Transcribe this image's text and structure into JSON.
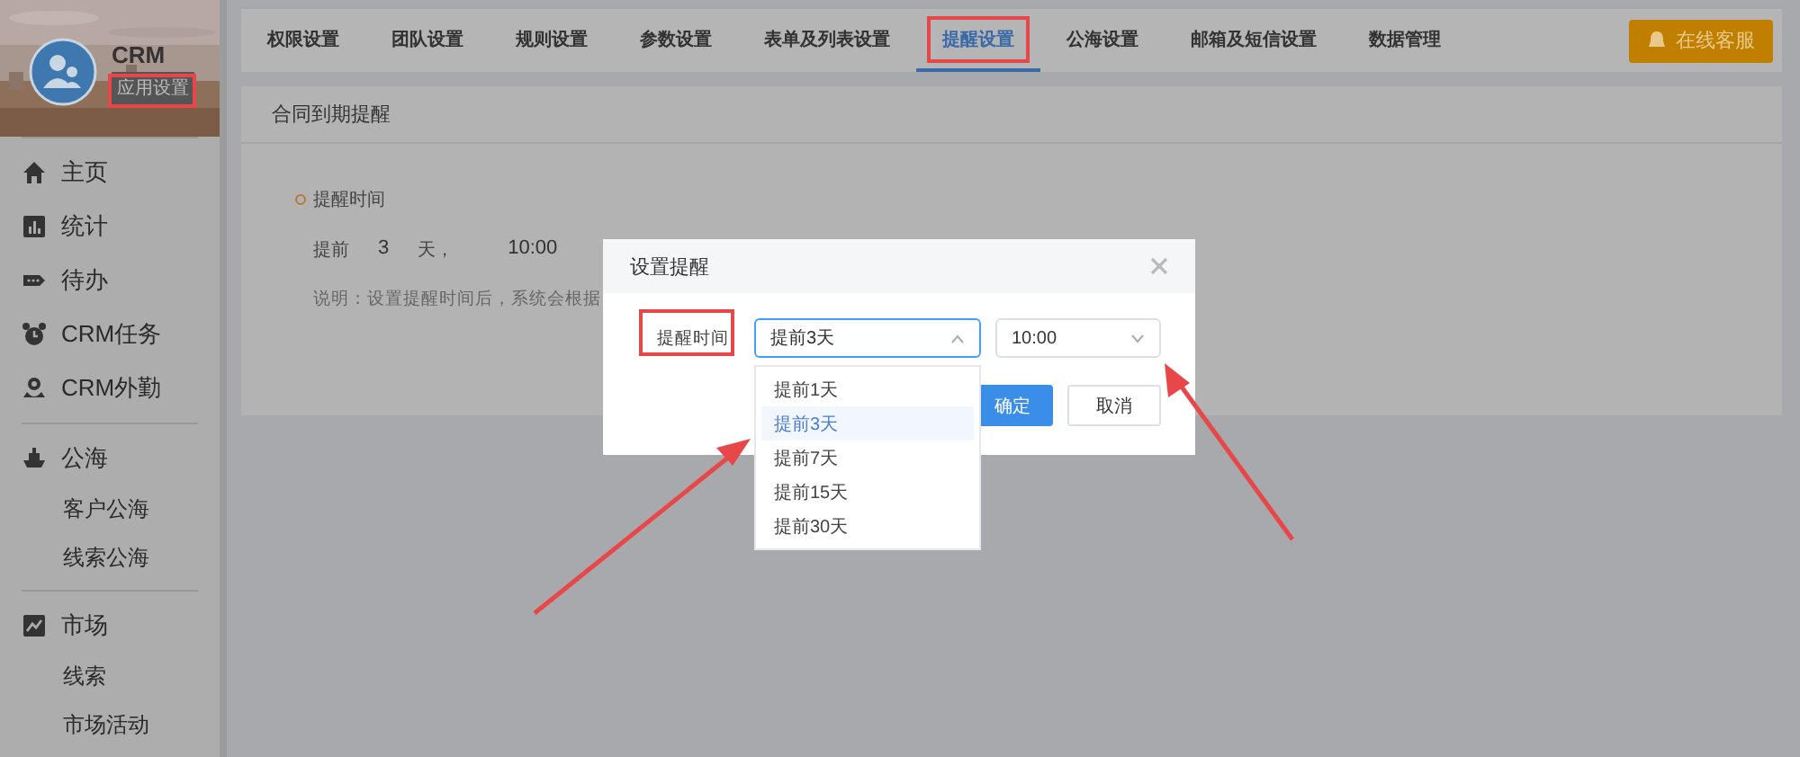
{
  "sidebar": {
    "app_name": "CRM",
    "app_badge": "应用设置",
    "groups": [
      {
        "items": [
          {
            "label": "主页",
            "kind": "main"
          },
          {
            "label": "统计",
            "kind": "main"
          },
          {
            "label": "待办",
            "kind": "main"
          },
          {
            "label": "CRM任务",
            "kind": "main"
          },
          {
            "label": "CRM外勤",
            "kind": "main"
          }
        ]
      },
      {
        "items": [
          {
            "label": "公海",
            "kind": "main"
          },
          {
            "label": "客户公海",
            "kind": "sub"
          },
          {
            "label": "线索公海",
            "kind": "sub"
          }
        ]
      },
      {
        "items": [
          {
            "label": "市场",
            "kind": "main"
          },
          {
            "label": "线索",
            "kind": "sub"
          },
          {
            "label": "市场活动",
            "kind": "sub"
          }
        ]
      }
    ]
  },
  "tabs": [
    {
      "label": "权限设置",
      "selected": false
    },
    {
      "label": "团队设置",
      "selected": false
    },
    {
      "label": "规则设置",
      "selected": false
    },
    {
      "label": "参数设置",
      "selected": false
    },
    {
      "label": "表单及列表设置",
      "selected": false
    },
    {
      "label": "提醒设置",
      "selected": true
    },
    {
      "label": "公海设置",
      "selected": false
    },
    {
      "label": "邮箱及短信设置",
      "selected": false
    },
    {
      "label": "数据管理",
      "selected": false
    }
  ],
  "support_button": "在线客服",
  "card": {
    "title": "合同到期提醒",
    "section_label": "提醒时间",
    "reminder": [
      "提前",
      "3",
      "天，",
      "10:00"
    ],
    "note": "说明：设置提醒时间后，系统会根据"
  },
  "dialog": {
    "title": "设置提醒",
    "field_label": "提醒时间",
    "day_select": {
      "value": "提前3天",
      "expanded": true
    },
    "time_select": {
      "value": "10:00",
      "expanded": false
    },
    "options": [
      {
        "label": "提前1天",
        "selected": false
      },
      {
        "label": "提前3天",
        "selected": true
      },
      {
        "label": "提前7天",
        "selected": false
      },
      {
        "label": "提前15天",
        "selected": false
      },
      {
        "label": "提前30天",
        "selected": false
      }
    ],
    "buttons": [
      "确定",
      "取消"
    ]
  }
}
